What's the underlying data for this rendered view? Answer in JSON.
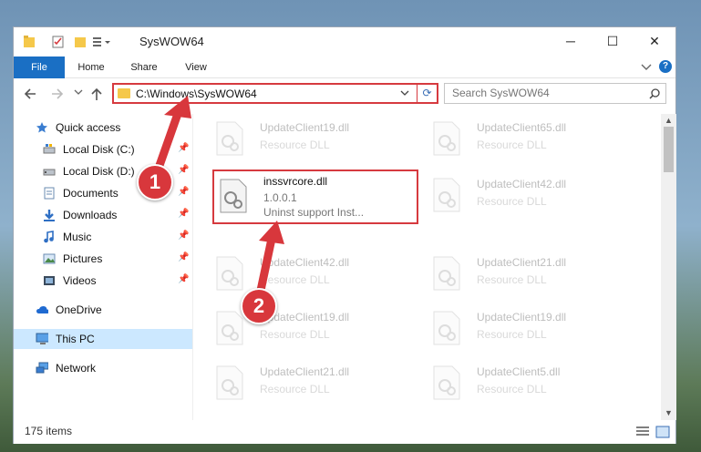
{
  "window": {
    "title": "SysWOW64",
    "controls": {
      "minimize": "─",
      "maximize": "☐",
      "close": "✕"
    }
  },
  "ribbon": {
    "tabs": [
      {
        "label": "File"
      },
      {
        "label": "Home"
      },
      {
        "label": "Share"
      },
      {
        "label": "View"
      }
    ],
    "expand_icon": "chevron-down-icon",
    "help_label": "?"
  },
  "navigation": {
    "address": "C:\\Windows\\SysWOW64",
    "search_placeholder": "Search SysWOW64"
  },
  "sidebar": {
    "items": [
      {
        "label": "Quick access",
        "icon": "star-icon",
        "pinned": false
      },
      {
        "label": "Local Disk (C:)",
        "icon": "drive-icon",
        "pinned": true
      },
      {
        "label": "Local Disk (D:)",
        "icon": "drive-icon",
        "pinned": true
      },
      {
        "label": "Documents",
        "icon": "documents-icon",
        "pinned": true
      },
      {
        "label": "Downloads",
        "icon": "downloads-icon",
        "pinned": true
      },
      {
        "label": "Music",
        "icon": "music-icon",
        "pinned": true
      },
      {
        "label": "Pictures",
        "icon": "pictures-icon",
        "pinned": true
      },
      {
        "label": "Videos",
        "icon": "videos-icon",
        "pinned": true
      },
      {
        "label": "OneDrive",
        "icon": "cloud-icon",
        "pinned": false
      },
      {
        "label": "This PC",
        "icon": "computer-icon",
        "pinned": false,
        "selected": true
      },
      {
        "label": "Network",
        "icon": "network-icon",
        "pinned": false
      }
    ]
  },
  "files": {
    "left": [
      {
        "name": "UpdateClient19.dll",
        "type": "Resource DLL"
      },
      {
        "name": "inssvrcore.dll",
        "version": "1.0.0.1",
        "description": "Uninst support Inst...",
        "highlighted": true
      },
      {
        "name": "UpdateClient42.dll",
        "type": "Resource DLL"
      },
      {
        "name": "UpdateClient19.dll",
        "type": "Resource DLL"
      },
      {
        "name": "UpdateClient21.dll",
        "type": "Resource DLL"
      }
    ],
    "right": [
      {
        "name": "UpdateClient65.dll",
        "type": "Resource DLL"
      },
      {
        "name": "UpdateClient42.dll",
        "type": "Resource DLL"
      },
      {
        "name": "UpdateClient21.dll",
        "type": "Resource DLL"
      },
      {
        "name": "UpdateClient19.dll",
        "type": "Resource DLL"
      },
      {
        "name": "UpdateClient5.dll",
        "type": "Resource DLL"
      }
    ]
  },
  "statusbar": {
    "item_count": "175 items"
  },
  "annotations": {
    "step1": "1",
    "step2": "2",
    "color": "#d8373c"
  }
}
